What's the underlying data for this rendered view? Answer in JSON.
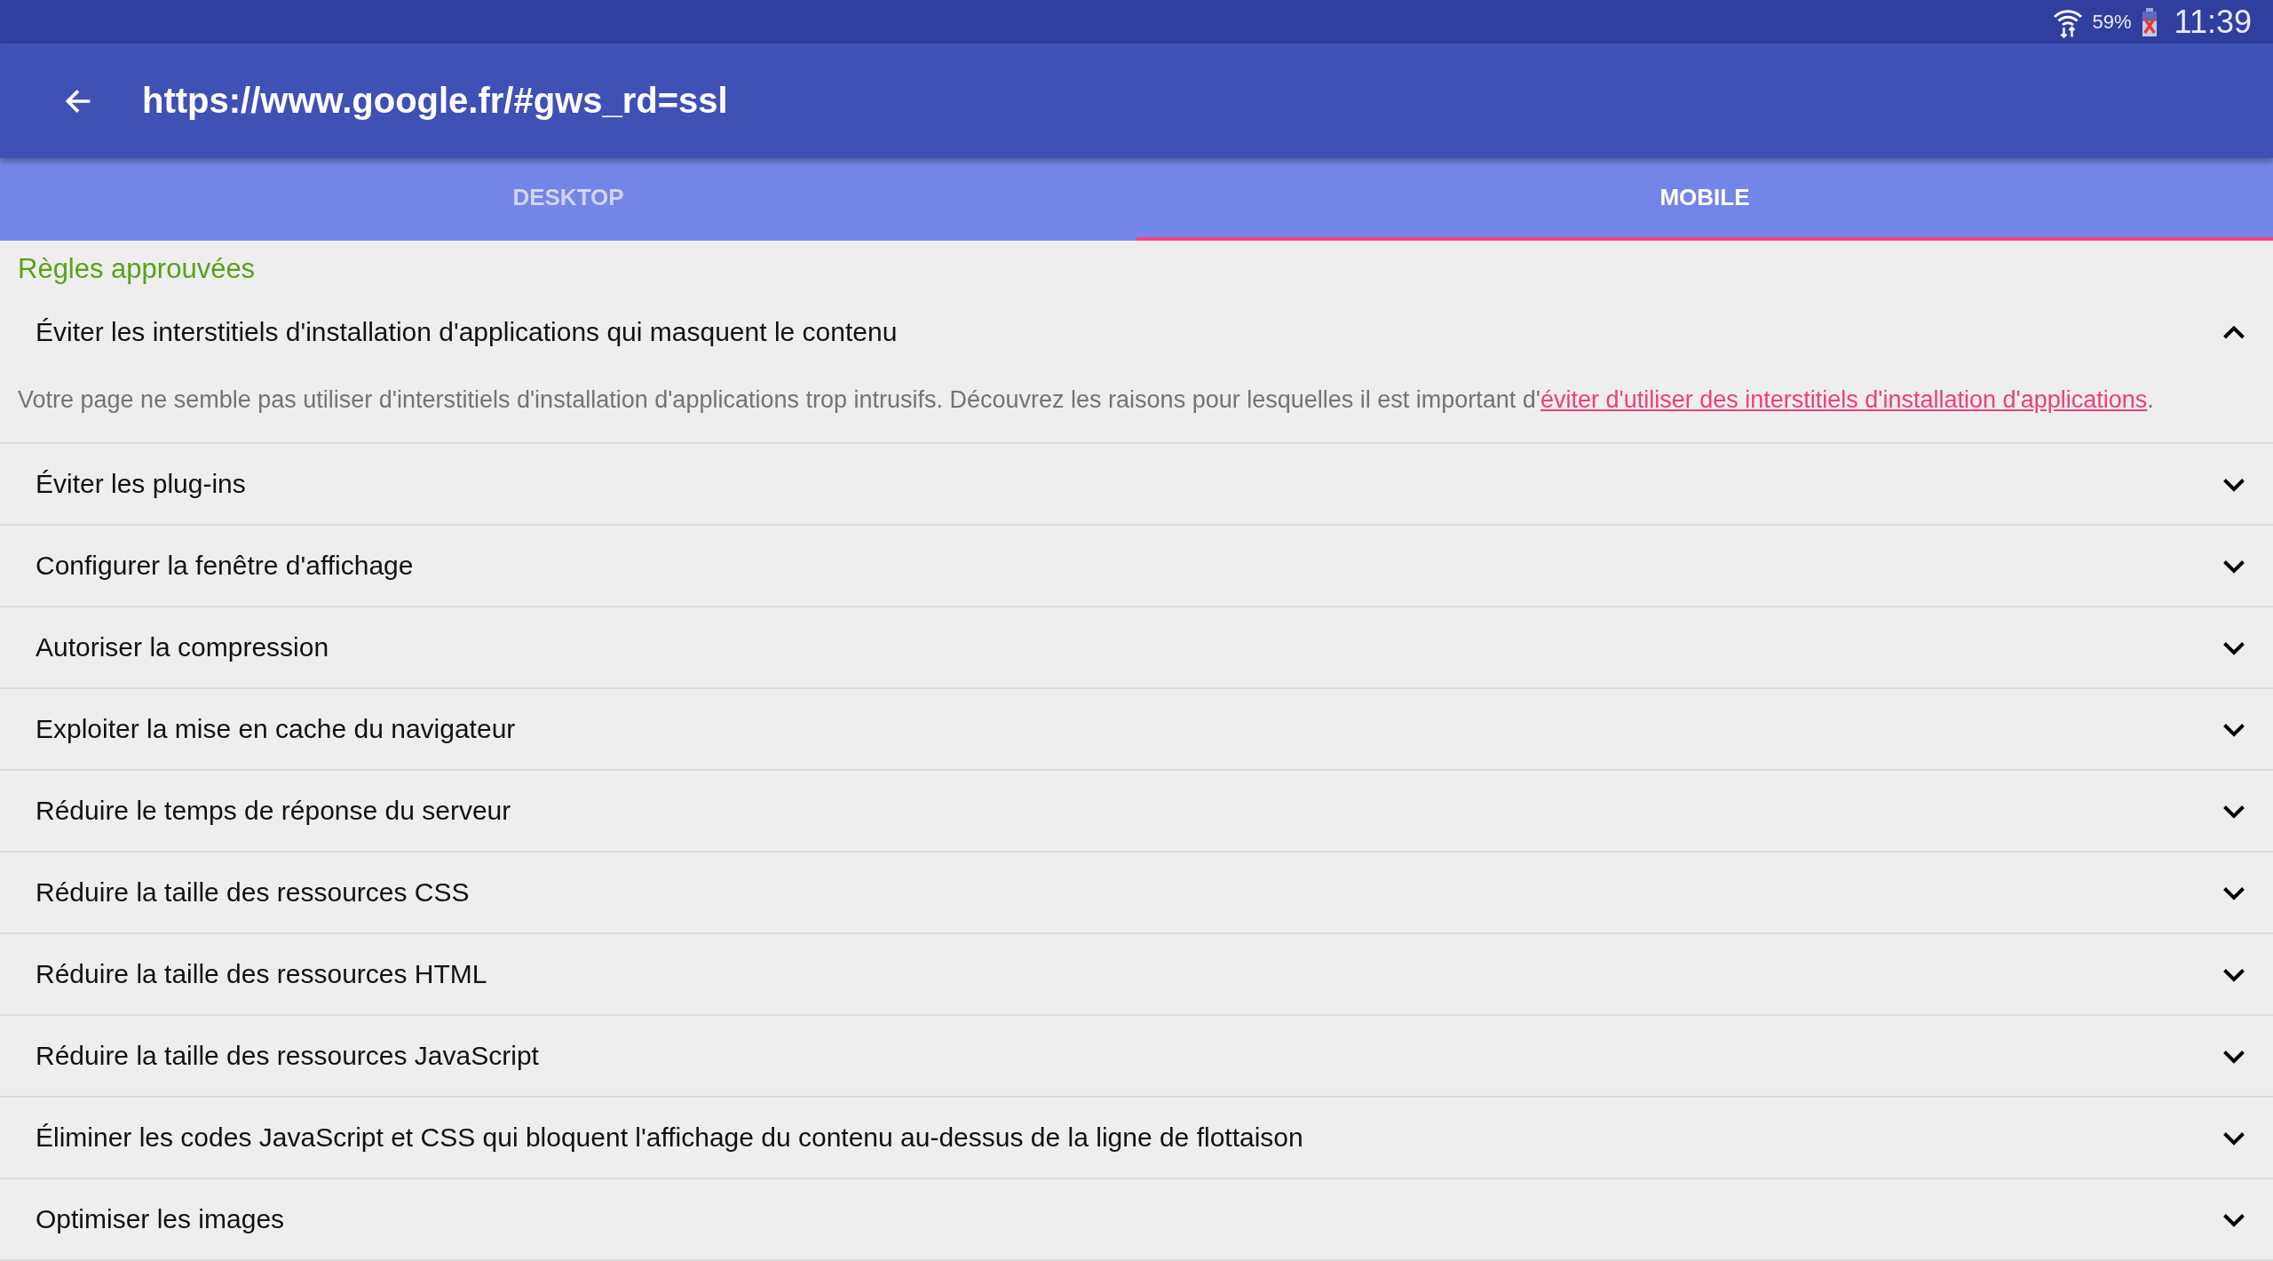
{
  "status_bar": {
    "battery": "59%",
    "time": "11:39"
  },
  "app_bar": {
    "title": "https://www.google.fr/#gws_rd=ssl"
  },
  "tabs": [
    {
      "label": "DESKTOP",
      "selected": false
    },
    {
      "label": "MOBILE",
      "selected": true
    }
  ],
  "section_title": "Règles approuvées",
  "rules": [
    {
      "title": "Éviter les interstitiels d'installation d'applications qui masquent le contenu",
      "expanded": true,
      "description": {
        "text": "Votre page ne semble pas utiliser d'interstitiels d'installation d'applications trop intrusifs. Découvrez les raisons pour lesquelles il est important d'",
        "link": "éviter d'utiliser des interstitiels d'installation d'applications",
        "after": "."
      }
    },
    {
      "title": "Éviter les plug-ins",
      "expanded": false
    },
    {
      "title": "Configurer la fenêtre d'affichage",
      "expanded": false
    },
    {
      "title": "Autoriser la compression",
      "expanded": false
    },
    {
      "title": "Exploiter la mise en cache du navigateur",
      "expanded": false
    },
    {
      "title": "Réduire le temps de réponse du serveur",
      "expanded": false
    },
    {
      "title": "Réduire la taille des ressources CSS",
      "expanded": false
    },
    {
      "title": "Réduire la taille des ressources HTML",
      "expanded": false
    },
    {
      "title": "Réduire la taille des ressources JavaScript",
      "expanded": false
    },
    {
      "title": "Éliminer les codes JavaScript et CSS qui bloquent l'affichage du contenu au-dessus de la ligne de flottaison",
      "expanded": false
    },
    {
      "title": "Optimiser les images",
      "expanded": false
    }
  ]
}
